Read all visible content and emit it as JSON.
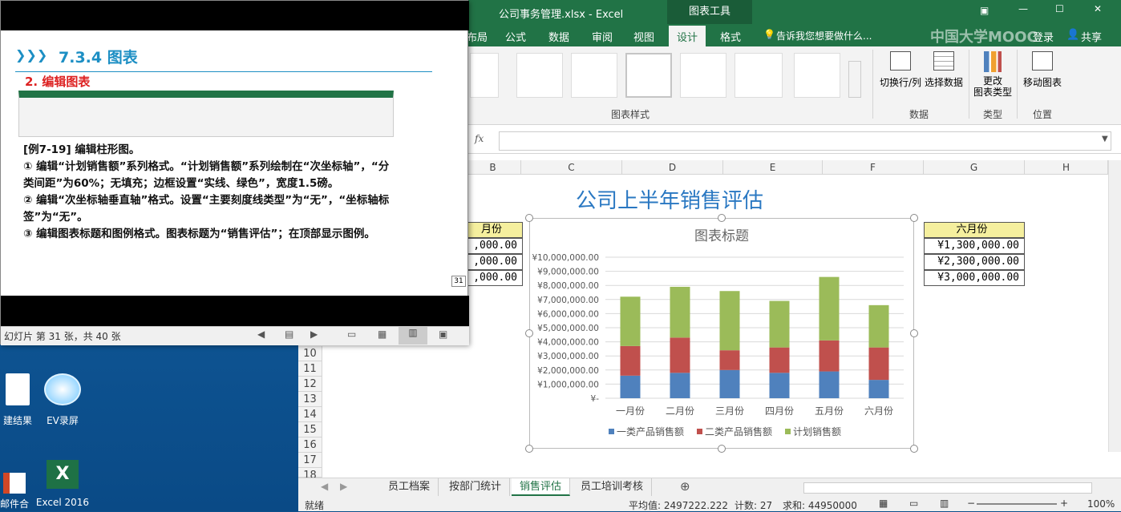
{
  "desktop": {
    "icons": [
      {
        "label": "建结果",
        "icon": "document-icon"
      },
      {
        "label": "EV录屏",
        "icon": "ev-recorder-icon"
      },
      {
        "label": "邮件合",
        "icon": "powerpoint-icon"
      },
      {
        "label": "Excel 2016",
        "icon": "excel-icon"
      }
    ]
  },
  "excel": {
    "title": "公司事务管理.xlsx - Excel",
    "context_tab": "图表工具",
    "tabs": [
      "布局",
      "公式",
      "数据",
      "审阅",
      "视图",
      "设计",
      "格式"
    ],
    "active_tab": "设计",
    "tell_me": "告诉我您想要做什么...",
    "login": "登录",
    "share": "共享",
    "watermark": "中国大学MOOC",
    "ribbon": {
      "styles_group": "图表样式",
      "switch_row_col": "切换行/列",
      "select_data": "选择数据",
      "data_group": "数据",
      "change_type": "更改\n图表类型",
      "type_group": "类型",
      "move_chart": "移动图表",
      "location_group": "位置"
    },
    "formula_bar": {
      "fx": "fx",
      "value": ""
    },
    "columns": [
      "B",
      "C",
      "D",
      "E",
      "F",
      "G",
      "H"
    ],
    "rows": [
      "10",
      "11",
      "12",
      "13",
      "14",
      "15",
      "16",
      "17",
      "18"
    ],
    "sheet_title": "公司上半年销售评估",
    "left_cells": {
      "header": "月份",
      "values": [
        ",000.00",
        ",000.00",
        ",000.00"
      ]
    },
    "right_cells": {
      "header": "六月份",
      "values": [
        "¥1,300,000.00",
        "¥2,300,000.00",
        "¥3,000,000.00"
      ]
    },
    "sheets": [
      "员工档案",
      "按部门统计",
      "销售评估",
      "员工培训考核"
    ],
    "active_sheet": "销售评估",
    "status": {
      "ready": "就绪",
      "average": "平均值: 2497222.222",
      "count": "计数: 27",
      "sum": "求和: 44950000",
      "zoom": "100%"
    }
  },
  "ppt": {
    "heading": "7.3.4  图表",
    "subheading": "2. 编辑图表",
    "body": [
      "[例7-19] 编辑柱形图。",
      "① 编辑“计划销售额”系列格式。“计划销售额”系列绘制在“次坐标轴”，“分类间距”为60%；无填充；边框设置“实线、绿色”，宽度1.5磅。",
      "② 编辑“次坐标轴垂直轴”格式。设置“主要刻度线类型”为“无”，“坐标轴标签”为“无”。",
      "③ 编辑图表标题和图例格式。图表标题为“销售评估”；在顶部显示图例。"
    ],
    "slide_number": "31",
    "status": "幻灯片 第 31 张，共 40 张"
  },
  "chart_data": {
    "type": "bar",
    "stacked": true,
    "title": "图表标题",
    "categories": [
      "一月份",
      "二月份",
      "三月份",
      "四月份",
      "五月份",
      "六月份"
    ],
    "series": [
      {
        "name": "一类产品销售额",
        "color": "#4f81bd",
        "values": [
          1600000,
          1800000,
          2000000,
          1800000,
          1900000,
          1300000
        ]
      },
      {
        "name": "二类产品销售额",
        "color": "#c0504d",
        "values": [
          2100000,
          2500000,
          1400000,
          1800000,
          2200000,
          2300000
        ]
      },
      {
        "name": "计划销售额",
        "color": "#9bbb59",
        "values": [
          3500000,
          3600000,
          4200000,
          3300000,
          4500000,
          3000000
        ]
      }
    ],
    "yticks": [
      "¥-",
      "¥1,000,000.00",
      "¥2,000,000.00",
      "¥3,000,000.00",
      "¥4,000,000.00",
      "¥5,000,000.00",
      "¥6,000,000.00",
      "¥7,000,000.00",
      "¥8,000,000.00",
      "¥9,000,000.00",
      "¥10,000,000.00"
    ],
    "ylim": [
      0,
      10000000
    ],
    "legend": "bottom",
    "grid": true
  }
}
